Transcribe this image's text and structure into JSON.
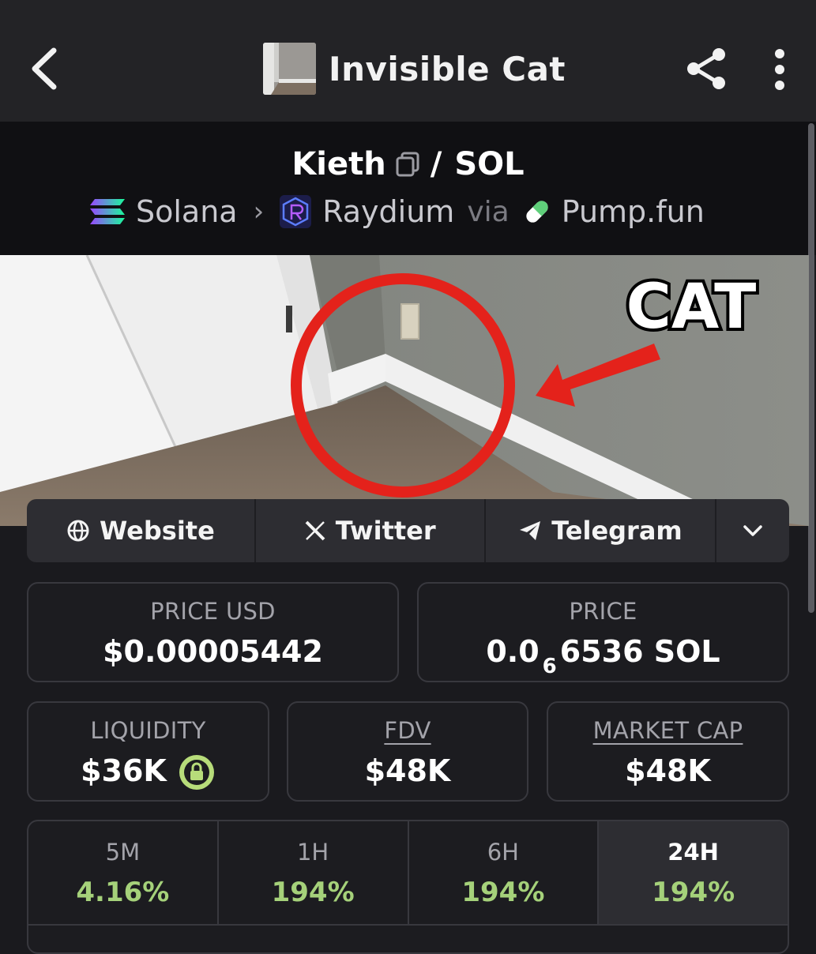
{
  "app": {
    "title": "Invisible Cat"
  },
  "pair": {
    "base": "Kieth",
    "separator": "/",
    "quote": "SOL",
    "chain": "Solana",
    "dex": "Raydium",
    "via_label": "via",
    "launchpad": "Pump.fun"
  },
  "banner": {
    "caption": "CAT"
  },
  "socials": {
    "website": "Website",
    "twitter": "Twitter",
    "telegram": "Telegram"
  },
  "stats": {
    "price_usd_label": "PRICE USD",
    "price_usd_value": "$0.00005442",
    "price_label": "PRICE",
    "price_prefix": "0.0",
    "price_sub": "6",
    "price_suffix": "6536 SOL",
    "liquidity_label": "LIQUIDITY",
    "liquidity_value": "$36K",
    "fdv_label": "FDV",
    "fdv_value": "$48K",
    "mcap_label": "MARKET CAP",
    "mcap_value": "$48K"
  },
  "changes": [
    {
      "label": "5M",
      "value": "4.16%"
    },
    {
      "label": "1H",
      "value": "194%"
    },
    {
      "label": "6H",
      "value": "194%"
    },
    {
      "label": "24H",
      "value": "194%"
    }
  ],
  "colors": {
    "background": "#1a1a1e",
    "card_border": "#38383e",
    "positive": "#a5d17a",
    "lock_badge": "#b7dc7a"
  }
}
